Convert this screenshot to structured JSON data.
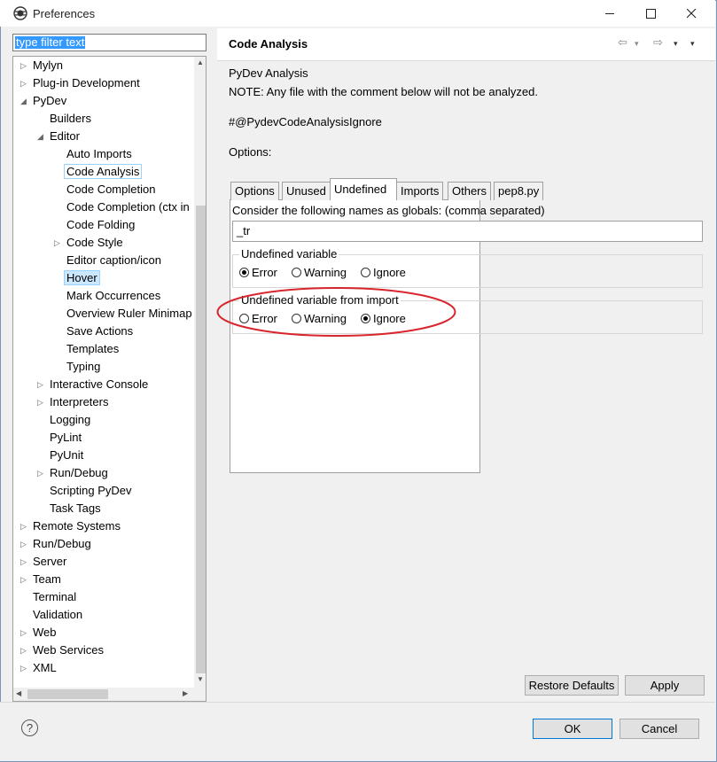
{
  "window": {
    "title": "Preferences",
    "minimize": "—",
    "maximize": "☐",
    "close": "✕"
  },
  "filter": {
    "text": "type filter text"
  },
  "tree": [
    {
      "label": "Mylyn",
      "arrow": "▷",
      "level": 0
    },
    {
      "label": "Plug-in Development",
      "arrow": "▷",
      "level": 0
    },
    {
      "label": "PyDev",
      "arrow": "◢",
      "level": 0
    },
    {
      "label": "Builders",
      "arrow": "",
      "level": 1
    },
    {
      "label": "Editor",
      "arrow": "◢",
      "level": 1
    },
    {
      "label": "Auto Imports",
      "arrow": "",
      "level": 2
    },
    {
      "label": "Code Analysis",
      "arrow": "",
      "level": 2,
      "selected": "focus"
    },
    {
      "label": "Code Completion",
      "arrow": "",
      "level": 2
    },
    {
      "label": "Code Completion (ctx in",
      "arrow": "",
      "level": 2
    },
    {
      "label": "Code Folding",
      "arrow": "",
      "level": 2
    },
    {
      "label": "Code Style",
      "arrow": "▷",
      "level": 2
    },
    {
      "label": "Editor caption/icon",
      "arrow": "",
      "level": 2
    },
    {
      "label": "Hover",
      "arrow": "",
      "level": 2,
      "selected": "hover"
    },
    {
      "label": "Mark Occurrences",
      "arrow": "",
      "level": 2
    },
    {
      "label": "Overview Ruler Minimap",
      "arrow": "",
      "level": 2
    },
    {
      "label": "Save Actions",
      "arrow": "",
      "level": 2
    },
    {
      "label": "Templates",
      "arrow": "",
      "level": 2
    },
    {
      "label": "Typing",
      "arrow": "",
      "level": 2
    },
    {
      "label": "Interactive Console",
      "arrow": "▷",
      "level": 1
    },
    {
      "label": "Interpreters",
      "arrow": "▷",
      "level": 1
    },
    {
      "label": "Logging",
      "arrow": "",
      "level": 1
    },
    {
      "label": "PyLint",
      "arrow": "",
      "level": 1
    },
    {
      "label": "PyUnit",
      "arrow": "",
      "level": 1
    },
    {
      "label": "Run/Debug",
      "arrow": "▷",
      "level": 1
    },
    {
      "label": "Scripting PyDev",
      "arrow": "",
      "level": 1
    },
    {
      "label": "Task Tags",
      "arrow": "",
      "level": 1
    },
    {
      "label": "Remote Systems",
      "arrow": "▷",
      "level": 0
    },
    {
      "label": "Run/Debug",
      "arrow": "▷",
      "level": 0
    },
    {
      "label": "Server",
      "arrow": "▷",
      "level": 0
    },
    {
      "label": "Team",
      "arrow": "▷",
      "level": 0
    },
    {
      "label": "Terminal",
      "arrow": "",
      "level": 0
    },
    {
      "label": "Validation",
      "arrow": "",
      "level": 0
    },
    {
      "label": "Web",
      "arrow": "▷",
      "level": 0
    },
    {
      "label": "Web Services",
      "arrow": "▷",
      "level": 0
    },
    {
      "label": "XML",
      "arrow": "▷",
      "level": 0
    }
  ],
  "page": {
    "title": "Code Analysis",
    "heading": "PyDev Analysis",
    "note": "NOTE: Any file with the comment below will not be analyzed.",
    "ignore_comment": "#@PydevCodeAnalysisIgnore",
    "options_label": "Options:"
  },
  "tabs": [
    "Options",
    "Unused",
    "Undefined",
    "Imports",
    "Others",
    "pep8.py"
  ],
  "active_tab": "Undefined",
  "undefined_tab": {
    "globals_label": "Consider the following names as globals: (comma separated)",
    "globals_value": "_tr",
    "group1": {
      "title": "Undefined variable",
      "options": [
        "Error",
        "Warning",
        "Ignore"
      ],
      "selected": "Error"
    },
    "group2": {
      "title": "Undefined variable from import",
      "options": [
        "Error",
        "Warning",
        "Ignore"
      ],
      "selected": "Ignore"
    }
  },
  "buttons": {
    "restore_defaults": "Restore Defaults",
    "apply": "Apply",
    "ok": "OK",
    "cancel": "Cancel",
    "help": "?"
  },
  "colors": {
    "highlight": "#3399ff",
    "annotation": "#d9262e",
    "focus": "#0078d7"
  }
}
